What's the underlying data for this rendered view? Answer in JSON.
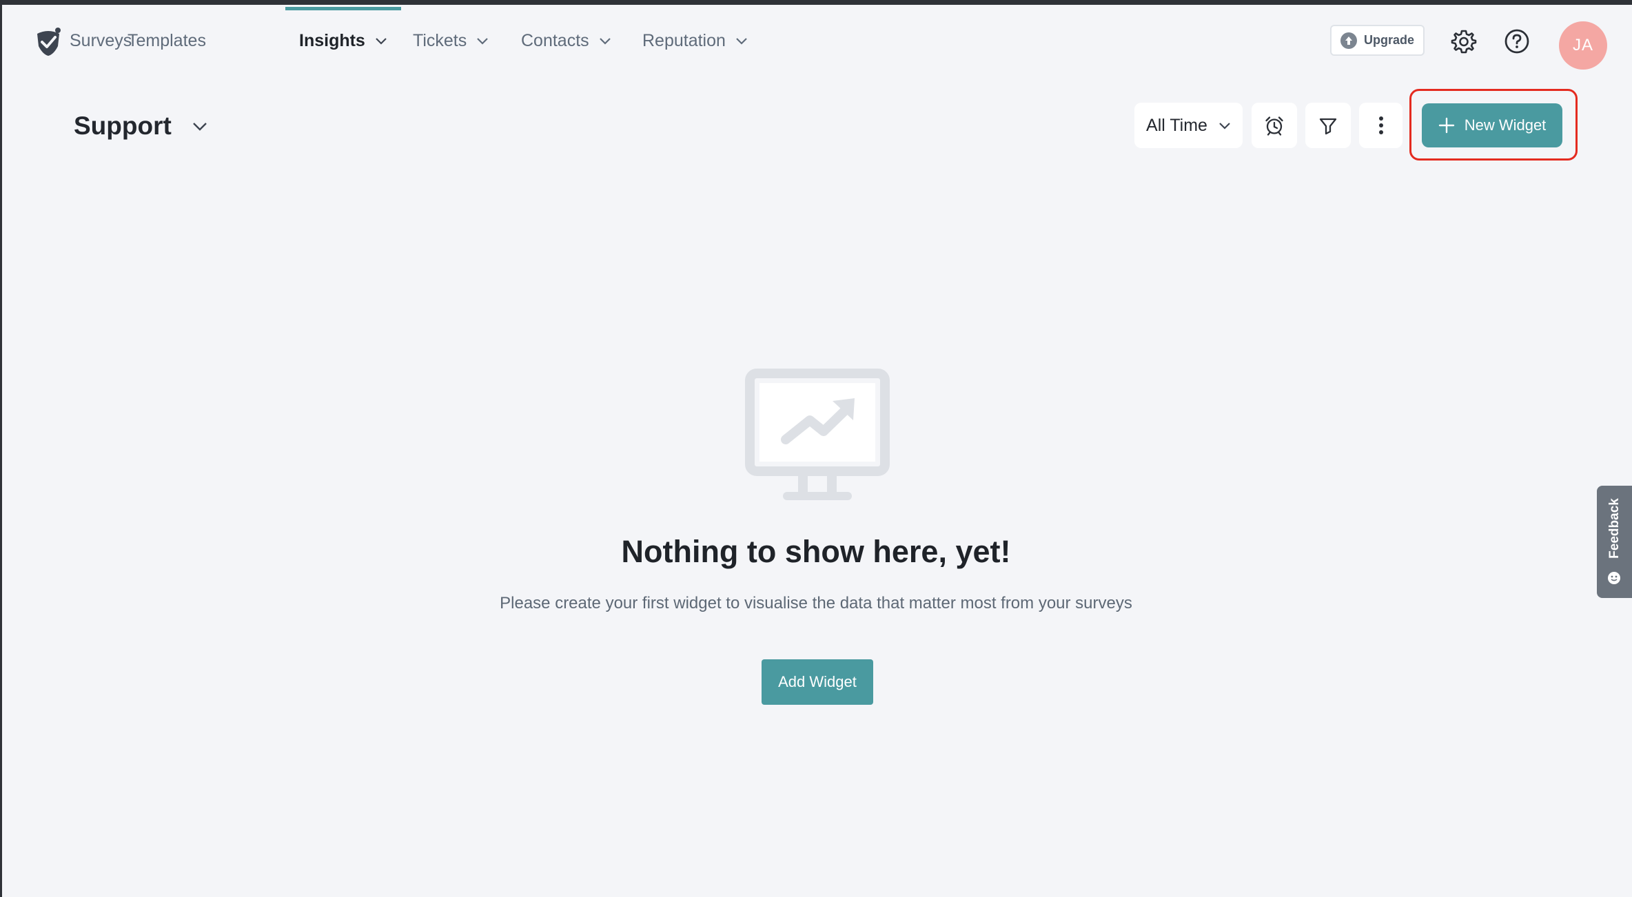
{
  "nav": {
    "items": [
      {
        "label": "Surveys"
      },
      {
        "label": "Templates"
      },
      {
        "label": "Insights"
      },
      {
        "label": "Tickets"
      },
      {
        "label": "Contacts"
      },
      {
        "label": "Reputation"
      }
    ],
    "active": "Insights",
    "upgrade_label": "Upgrade",
    "avatar_initials": "JA"
  },
  "header": {
    "dashboard_title": "Support",
    "time_range": "All Time",
    "new_widget_label": "New Widget"
  },
  "empty_state": {
    "title": "Nothing to show here, yet!",
    "subtitle": "Please create your first widget to visualise the data that matter most from your surveys",
    "button_label": "Add Widget"
  },
  "feedback": {
    "label": "Feedback"
  },
  "colors": {
    "accent": "#4a9aa0",
    "highlight": "#e42b20",
    "avatar": "#f4a7a3"
  },
  "icons": [
    "logo-icon",
    "chevron-down-icon",
    "upgrade-icon",
    "gear-icon",
    "help-icon",
    "alarm-clock-icon",
    "filter-icon",
    "more-vertical-icon",
    "plus-icon",
    "monitor-chart-icon",
    "feedback-smile-icon"
  ]
}
